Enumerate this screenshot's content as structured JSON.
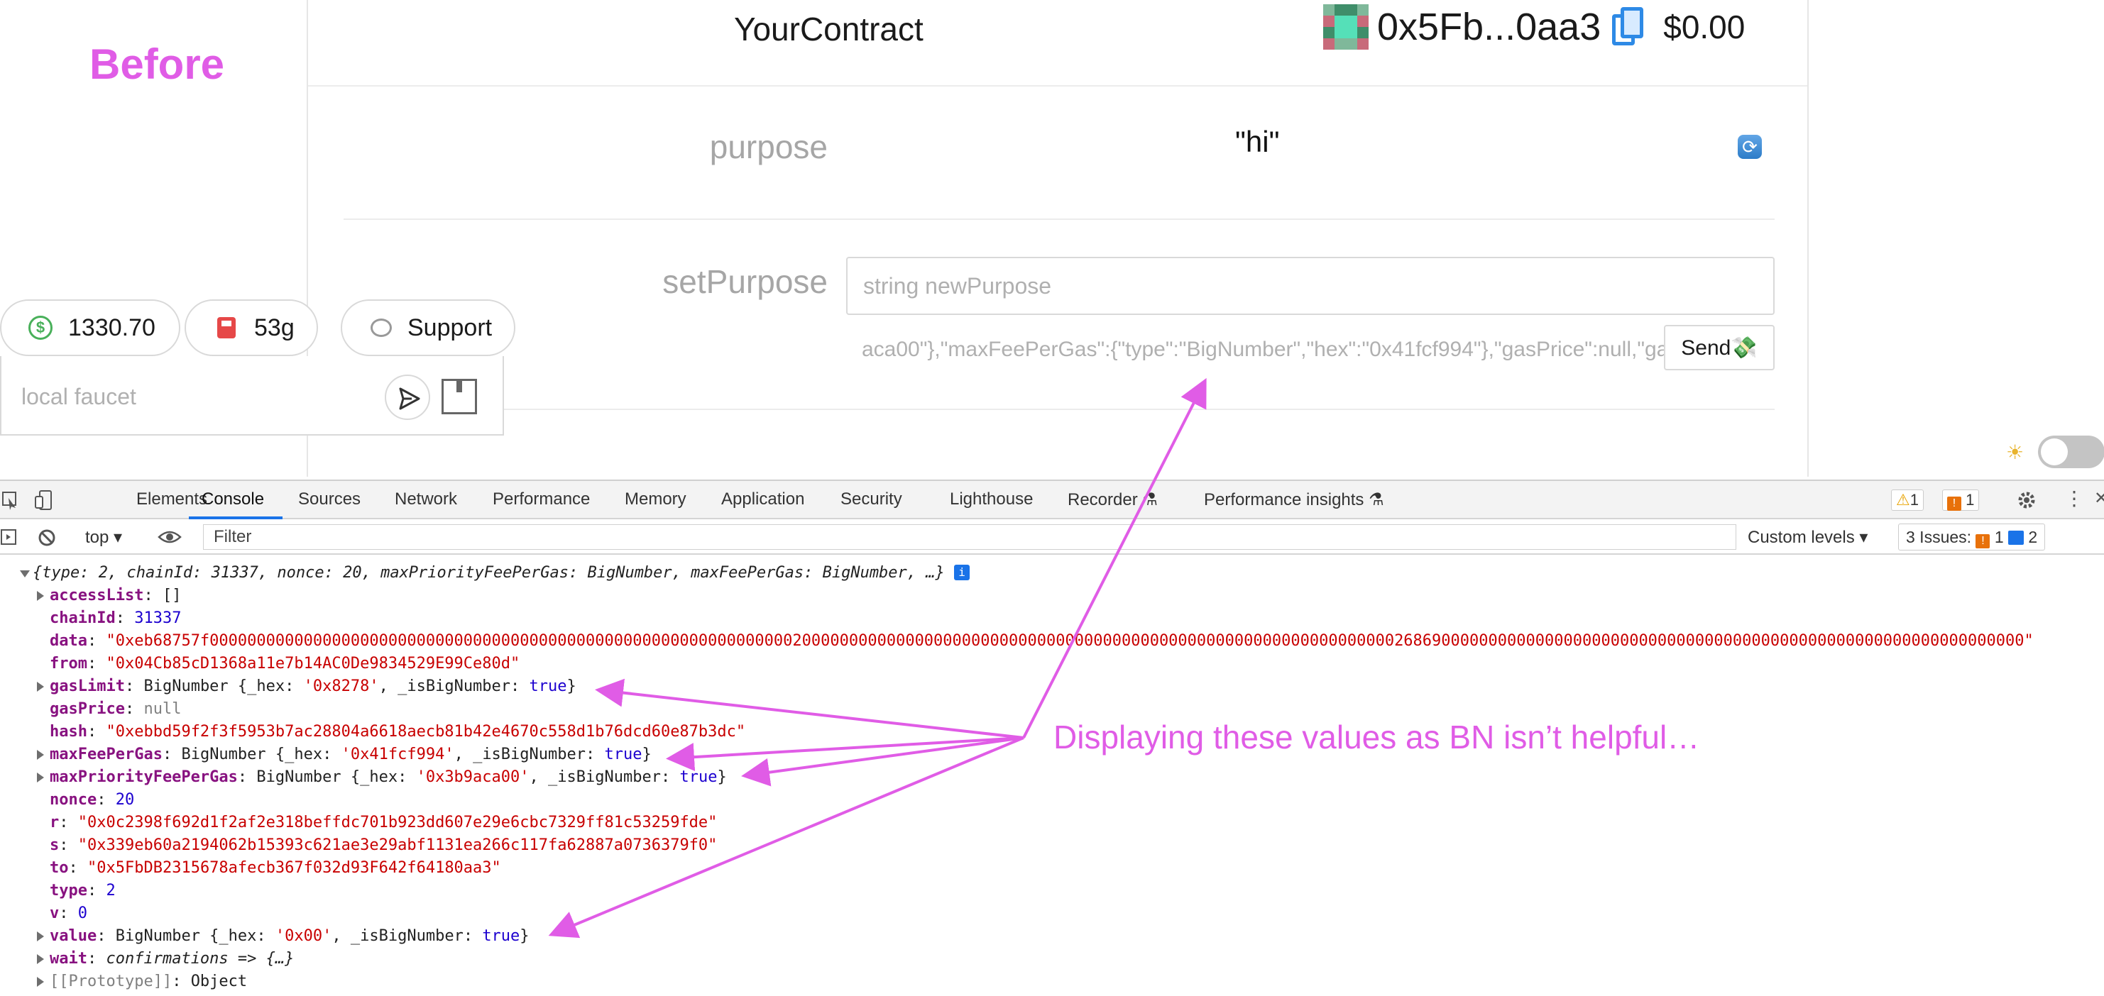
{
  "annotation": {
    "before_label": "Before",
    "note": "Displaying these values as BN isn’t helpful…"
  },
  "app": {
    "contract_name": "YourContract",
    "account": {
      "address": "0x5Fb...0aa3",
      "balance": "$0.00"
    },
    "purpose": {
      "label": "purpose",
      "value": "\"hi\""
    },
    "set_purpose": {
      "label": "setPurpose",
      "placeholder": "string newPurpose",
      "tx_preview": "aca00\"},\"maxFeePerGas\":{\"type\":\"BigNumber\",\"hex\":\"0x41fcf994\"},\"gasPrice\":null,\"gas",
      "send_label": "Send💸"
    },
    "eth_price": "1330.70",
    "gas_price": "53g",
    "support_label": "Support",
    "faucet_placeholder": "local faucet"
  },
  "devtools": {
    "tabs": [
      "Elements",
      "Console",
      "Sources",
      "Network",
      "Performance",
      "Memory",
      "Application",
      "Security",
      "Lighthouse",
      "Recorder",
      "Performance insights"
    ],
    "active_tab": "Console",
    "warnings_count": "1",
    "errors_count": "1",
    "context": "top",
    "filter_placeholder": "Filter",
    "levels": "Custom levels",
    "issues_label": "3 Issues:",
    "issues_errors": "1",
    "issues_info": "2",
    "console": {
      "summary": "{type: 2, chainId: 31337, nonce: 20, maxPriorityFeePerGas: BigNumber, maxFeePerGas: BigNumber, …}",
      "entries": [
        {
          "key": "accessList",
          "value": "[]",
          "kind": "plain"
        },
        {
          "key": "chainId",
          "value": "31337",
          "kind": "num"
        },
        {
          "key": "data",
          "value": "\"0xeb68757f0000000000000000000000000000000000000000000000000000000000000020000000000000000000000000000000000000000000000000000000000000002686900000000000000000000000000000000000000000000000000000000000000\"",
          "kind": "str"
        },
        {
          "key": "from",
          "value": "\"0x04Cb85cD1368a11e7b14AC0De9834529E99Ce80d\"",
          "kind": "str"
        },
        {
          "key": "gasLimit",
          "value_prefix": "BigNumber {_hex: ",
          "hex": "'0x8278'",
          "suffix": ", _isBigNumber: ",
          "bool": "true",
          "end": "}",
          "kind": "bn"
        },
        {
          "key": "gasPrice",
          "value": "null",
          "kind": "null"
        },
        {
          "key": "hash",
          "value": "\"0xebbd59f2f3f5953b7ac28804a6618aecb81b42e4670c558d1b76dcd60e87b3dc\"",
          "kind": "str"
        },
        {
          "key": "maxFeePerGas",
          "value_prefix": "BigNumber {_hex: ",
          "hex": "'0x41fcf994'",
          "suffix": ", _isBigNumber: ",
          "bool": "true",
          "end": "}",
          "kind": "bn"
        },
        {
          "key": "maxPriorityFeePerGas",
          "value_prefix": "BigNumber {_hex: ",
          "hex": "'0x3b9aca00'",
          "suffix": ", _isBigNumber: ",
          "bool": "true",
          "end": "}",
          "kind": "bn"
        },
        {
          "key": "nonce",
          "value": "20",
          "kind": "num"
        },
        {
          "key": "r",
          "value": "\"0x0c2398f692d1f2af2e318beffdc701b923dd607e29e6cbc7329ff81c53259fde\"",
          "kind": "str"
        },
        {
          "key": "s",
          "value": "\"0x339eb60a2194062b15393c621ae3e29abf1131ea266c117fa62887a0736379f0\"",
          "kind": "str"
        },
        {
          "key": "to",
          "value": "\"0x5FbDB2315678afecb367f032d93F642f64180aa3\"",
          "kind": "str"
        },
        {
          "key": "type",
          "value": "2",
          "kind": "num"
        },
        {
          "key": "v",
          "value": "0",
          "kind": "num"
        },
        {
          "key": "value",
          "value_prefix": "BigNumber {_hex: ",
          "hex": "'0x00'",
          "suffix": ", _isBigNumber: ",
          "bool": "true",
          "end": "}",
          "kind": "bn"
        },
        {
          "key": "wait",
          "value": "confirmations => {…}",
          "kind": "fn"
        },
        {
          "key": "[[Prototype]]",
          "value": "Object",
          "kind": "proto"
        }
      ]
    }
  },
  "colors": {
    "annotation": "#e05ce6",
    "accent": "#1a73e8",
    "console_key": "#881280",
    "console_string": "#c80000",
    "console_number": "#1c00cf"
  }
}
